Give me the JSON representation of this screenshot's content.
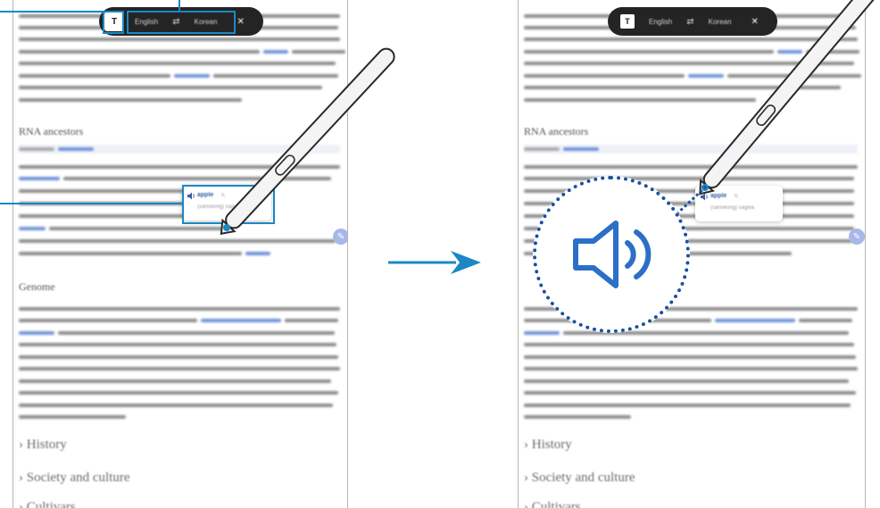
{
  "toolbar": {
    "source_language": "English",
    "swap_label": "⇄",
    "target_language": "Korean",
    "close_label": "✕",
    "translate_icon_label": "T"
  },
  "tooltip": {
    "speaker_glyph": "🔊",
    "word": "apple",
    "pos": "n.",
    "meaning": "(sanseong) sagwa"
  },
  "article": {
    "section_rna": "RNA ancestors",
    "section_genome": "Genome",
    "collapsed_sections": [
      "History",
      "Society and culture",
      "Cultivars"
    ]
  },
  "arrow": {
    "color": "#1b88c5"
  },
  "colors": {
    "callout": "#1b88c5",
    "zoom_border": "#1a4f9e",
    "toolbar_bg": "#242424"
  }
}
